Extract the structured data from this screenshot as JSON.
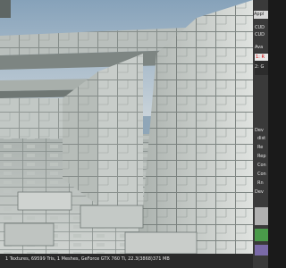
{
  "viewport": {
    "status_text": "1 Textures, 69599 Tris, 1 Meshes, GeForce GTX 760 Ti, 22.3(3868)371 MB"
  },
  "side_panel": {
    "tab_label": "Appl",
    "title_1": "CUD",
    "title_2": "CUD",
    "available_label": "Ava",
    "selected_item": "1: R",
    "item_2": "2: G",
    "device_label_1": "Dev",
    "device_fields": [
      "dist",
      "Re",
      "Rep",
      "Con",
      "Con",
      "Rn"
    ],
    "device_label_2": "Dev",
    "swatch_colors": [
      "#b0b0b0",
      "#4a9a4a",
      "#7a6aa8"
    ]
  },
  "colors": {
    "sky": "#8fa6b8",
    "stone": "#c7ccc8",
    "stone_dark": "#8a918e",
    "panel_bg": "#3a3a3a",
    "selection_text": "#cc0000"
  }
}
